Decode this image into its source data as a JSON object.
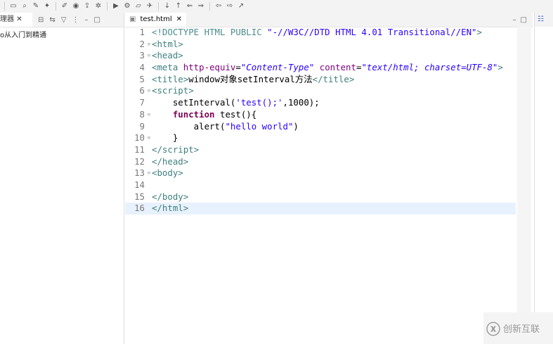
{
  "left_panel": {
    "tab_label": "理器",
    "tree_item": "o从入门到精通"
  },
  "editor": {
    "tab_label": "test.html",
    "lines": [
      [
        [
          "dt",
          "<!DOCTYPE HTML PUBLIC "
        ],
        [
          "str",
          "\"-//W3C//DTD HTML 4.01 Transitional//EN\""
        ],
        [
          "tag",
          ">"
        ]
      ],
      [
        [
          "tag",
          "<html>"
        ]
      ],
      [
        [
          "tag",
          "<head>"
        ]
      ],
      [
        [
          "tag",
          "<meta "
        ],
        [
          "attr",
          "http-equiv"
        ],
        [
          "plain",
          "="
        ],
        [
          "val",
          "\"Content-Type\""
        ],
        [
          "attr",
          " content"
        ],
        [
          "plain",
          "="
        ],
        [
          "val",
          "\"text/html; charset=UTF-8\""
        ],
        [
          "tag",
          ">"
        ]
      ],
      [
        [
          "tag",
          "<title>"
        ],
        [
          "plain",
          "window对象setInterval方法"
        ],
        [
          "tag",
          "</title>"
        ]
      ],
      [
        [
          "tag",
          "<script>"
        ]
      ],
      [
        [
          "plain",
          "    setInterval("
        ],
        [
          "str",
          "'test();'"
        ],
        [
          "plain",
          ",1000);"
        ]
      ],
      [
        [
          "plain",
          "    "
        ],
        [
          "kw",
          "function"
        ],
        [
          "plain",
          " test(){"
        ]
      ],
      [
        [
          "plain",
          "        alert("
        ],
        [
          "str",
          "\"hello world\""
        ],
        [
          "plain",
          ")"
        ]
      ],
      [
        [
          "plain",
          "    }"
        ]
      ],
      [
        [
          "tag",
          "</script>"
        ]
      ],
      [
        [
          "tag",
          "</head>"
        ]
      ],
      [
        [
          "tag",
          "<body>"
        ]
      ],
      [
        [
          "plain",
          ""
        ]
      ],
      [
        [
          "tag",
          "</body>"
        ]
      ],
      [
        [
          "tag",
          "</html>"
        ]
      ]
    ],
    "folds": [
      2,
      3,
      6,
      8,
      10,
      13
    ],
    "current_line": 16
  },
  "watermark": {
    "text": "创新互联"
  }
}
